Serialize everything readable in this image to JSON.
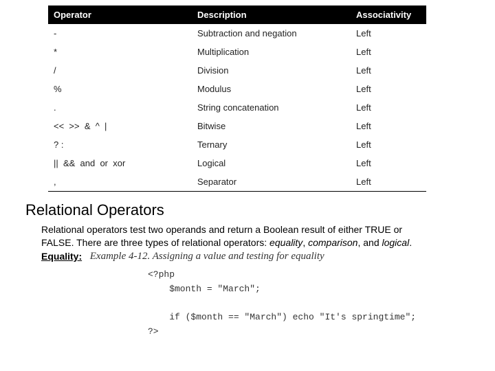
{
  "table": {
    "headers": [
      "Operator",
      "Description",
      "Associativity"
    ],
    "rows": [
      {
        "op": "-",
        "desc": "Subtraction and negation",
        "assoc": "Left"
      },
      {
        "op": "*",
        "desc": "Multiplication",
        "assoc": "Left"
      },
      {
        "op": "/",
        "desc": "Division",
        "assoc": "Left"
      },
      {
        "op": "%",
        "desc": "Modulus",
        "assoc": "Left"
      },
      {
        "op": ".",
        "desc": "String concatenation",
        "assoc": "Left"
      },
      {
        "op": "<<  >>  &  ^  |",
        "desc": "Bitwise",
        "assoc": "Left"
      },
      {
        "op": "? :",
        "desc": "Ternary",
        "assoc": "Left"
      },
      {
        "op": "||  &&  and  or  xor",
        "desc": "Logical",
        "assoc": "Left"
      },
      {
        "op": ",",
        "desc": "Separator",
        "assoc": "Left"
      }
    ]
  },
  "section_heading": "Relational Operators",
  "paragraph_part1": "Relational operators test two operands and return a Boolean result of either TRUE or FALSE. There are three types of relational operators: ",
  "em_equality": "equality",
  "comma1": ", ",
  "em_comparison": "comparison",
  "comma2": ", and ",
  "em_logical": "logical",
  "period": ".",
  "equality_label": "Equality:",
  "example_caption": "Example 4-12. Assigning a value and testing for equality",
  "code_line1": "<?php",
  "code_line2": "    $month = \"March\";",
  "code_line3": "",
  "code_line4": "    if ($month == \"March\") echo \"It's springtime\";",
  "code_line5": "?>"
}
